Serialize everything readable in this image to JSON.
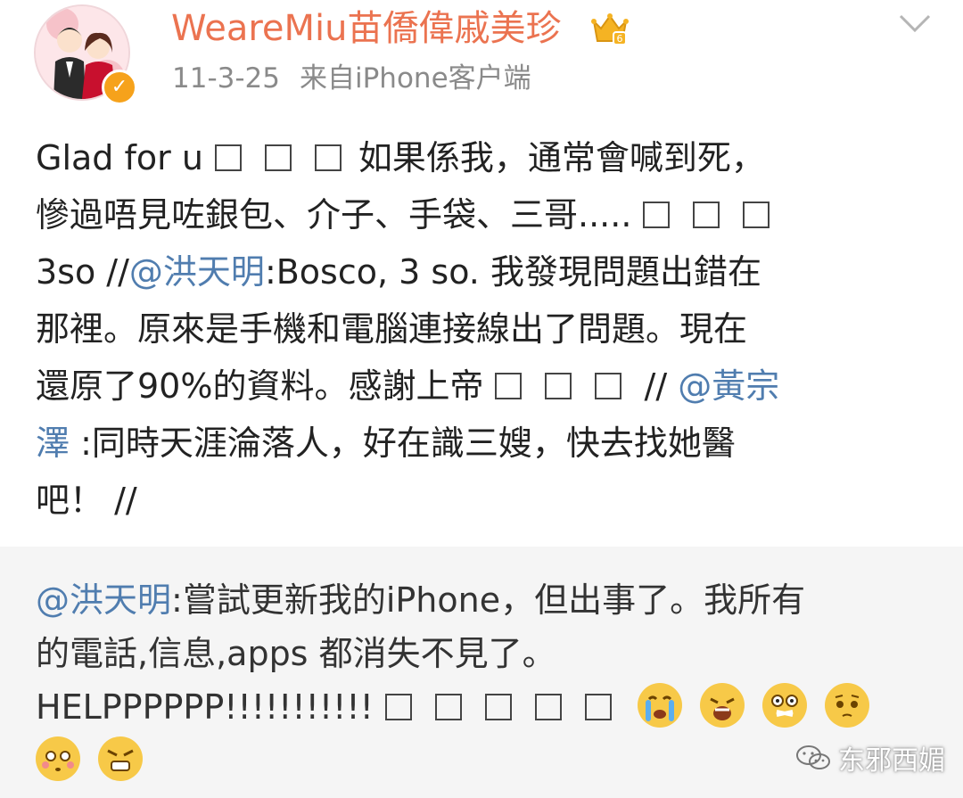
{
  "header": {
    "username": "WeareMiu苗僑偉戚美珍",
    "date": "11-3-25",
    "source": "来自iPhone客户端",
    "verified_color": "#f6a21b",
    "username_color": "#eb7350"
  },
  "post": {
    "lines": [
      [
        "Glad for u",
        "",
        "如果係我，通常會喊到死，"
      ],
      [
        "慘過唔見咗銀包、介子、手袋、三哥....."
      ],
      [
        "3so //",
        "@洪天明",
        ":Bosco, 3 so. 我發現問題出錯在"
      ],
      [
        "那裡。原來是手機和電腦連接線出了問題。現在"
      ],
      [
        "還原了90%的資料。感謝上帝",
        " // ",
        "@黃宗"
      ],
      [
        "澤",
        " :同時天涯淪落人，好在識三嫂，快去找她醫"
      ],
      [
        "吧！ //"
      ]
    ]
  },
  "repost": {
    "mention": "@洪天明",
    "line1_rest": ":嘗試更新我的iPhone，但出事了。我所有",
    "line2": "的電話,信息,apps 都消失不見了。",
    "line3": "HELPPPPPP!!!!!!!!!!!"
  },
  "mention_color": "#507daf",
  "watermark": "东邪西媚"
}
